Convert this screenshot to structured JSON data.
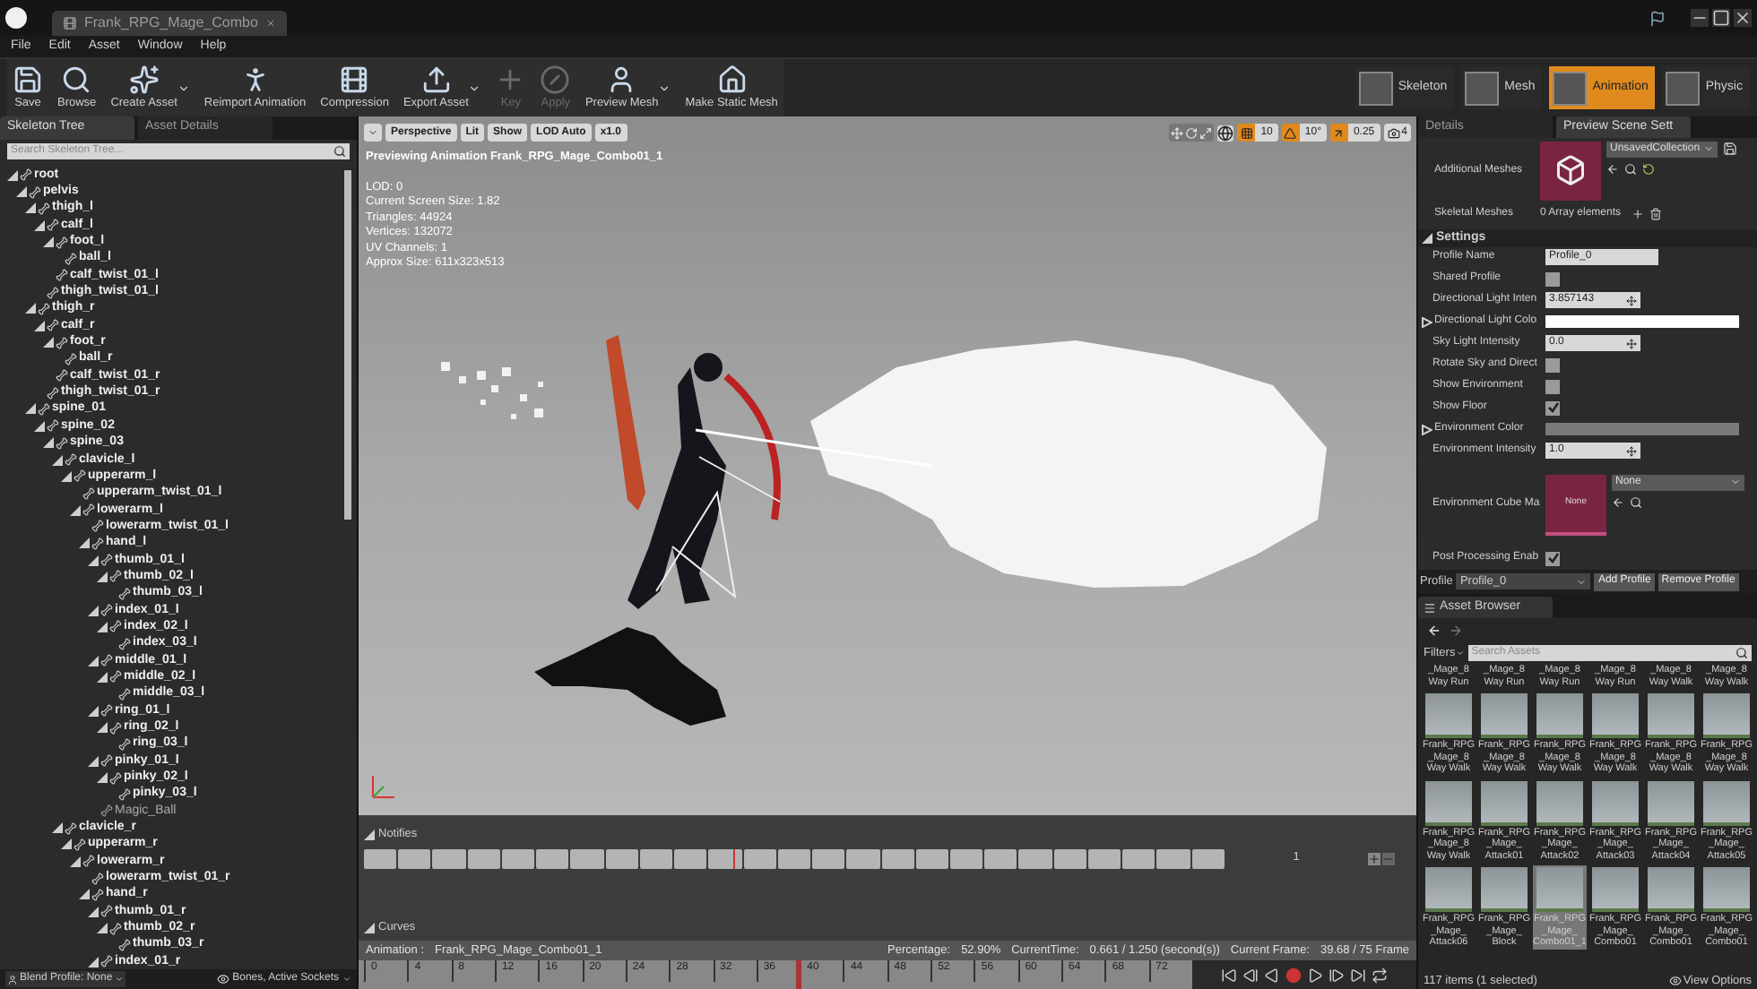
{
  "window": {
    "tab": "Frank_RPG_Mage_Combo"
  },
  "menu": [
    "File",
    "Edit",
    "Asset",
    "Window",
    "Help"
  ],
  "toolbar": [
    {
      "label": "Save",
      "dropdown": false,
      "disabled": false
    },
    {
      "label": "Browse",
      "dropdown": false,
      "disabled": false
    },
    {
      "label": "Create Asset",
      "dropdown": true,
      "disabled": false
    },
    {
      "label": "Reimport Animation",
      "dropdown": false,
      "disabled": false
    },
    {
      "label": "Compression",
      "dropdown": false,
      "disabled": false
    },
    {
      "label": "Export Asset",
      "dropdown": true,
      "disabled": false
    },
    {
      "label": "Key",
      "dropdown": false,
      "disabled": true
    },
    {
      "label": "Apply",
      "dropdown": false,
      "disabled": true
    },
    {
      "label": "Preview Mesh",
      "dropdown": true,
      "disabled": false
    },
    {
      "label": "Make Static Mesh",
      "dropdown": false,
      "disabled": false
    }
  ],
  "modes": [
    {
      "label": "Skeleton",
      "selected": false
    },
    {
      "label": "Mesh",
      "selected": false
    },
    {
      "label": "Animation",
      "selected": true
    },
    {
      "label": "Physic",
      "selected": false
    }
  ],
  "left_panel": {
    "tabs": [
      {
        "label": "Skeleton Tree",
        "selected": true
      },
      {
        "label": "Asset Details",
        "selected": false
      }
    ],
    "search": {
      "placeholder": "Search Skeleton Tree..."
    },
    "tree": [
      {
        "label": "root",
        "kind": "bone",
        "expanded": true,
        "children": [
          {
            "label": "pelvis",
            "kind": "bone",
            "expanded": true,
            "children": [
              {
                "label": "thigh_l",
                "kind": "bone",
                "expanded": true,
                "children": [
                  {
                    "label": "calf_l",
                    "kind": "bone",
                    "expanded": true,
                    "children": [
                      {
                        "label": "foot_l",
                        "kind": "bone",
                        "expanded": true,
                        "children": [
                          {
                            "label": "ball_l",
                            "kind": "bone"
                          }
                        ]
                      },
                      {
                        "label": "calf_twist_01_l",
                        "kind": "bone"
                      }
                    ]
                  },
                  {
                    "label": "thigh_twist_01_l",
                    "kind": "bone"
                  }
                ]
              },
              {
                "label": "thigh_r",
                "kind": "bone",
                "expanded": true,
                "children": [
                  {
                    "label": "calf_r",
                    "kind": "bone",
                    "expanded": true,
                    "children": [
                      {
                        "label": "foot_r",
                        "kind": "bone",
                        "expanded": true,
                        "children": [
                          {
                            "label": "ball_r",
                            "kind": "bone"
                          }
                        ]
                      },
                      {
                        "label": "calf_twist_01_r",
                        "kind": "bone"
                      }
                    ]
                  },
                  {
                    "label": "thigh_twist_01_r",
                    "kind": "bone"
                  }
                ]
              },
              {
                "label": "spine_01",
                "kind": "bone",
                "expanded": true,
                "children": [
                  {
                    "label": "spine_02",
                    "kind": "bone",
                    "expanded": true,
                    "children": [
                      {
                        "label": "spine_03",
                        "kind": "bone",
                        "expanded": true,
                        "children": [
                          {
                            "label": "clavicle_l",
                            "kind": "bone",
                            "expanded": true,
                            "children": [
                              {
                                "label": "upperarm_l",
                                "kind": "bone",
                                "expanded": true,
                                "children": [
                                  {
                                    "label": "upperarm_twist_01_l",
                                    "kind": "bone"
                                  },
                                  {
                                    "label": "lowerarm_l",
                                    "kind": "bone",
                                    "expanded": true,
                                    "children": [
                                      {
                                        "label": "lowerarm_twist_01_l",
                                        "kind": "bone"
                                      },
                                      {
                                        "label": "hand_l",
                                        "kind": "bone",
                                        "expanded": true,
                                        "children": [
                                          {
                                            "label": "thumb_01_l",
                                            "kind": "bone",
                                            "expanded": true,
                                            "children": [
                                              {
                                                "label": "thumb_02_l",
                                                "kind": "bone",
                                                "expanded": true,
                                                "children": [
                                                  {
                                                    "label": "thumb_03_l",
                                                    "kind": "bone"
                                                  }
                                                ]
                                              }
                                            ]
                                          },
                                          {
                                            "label": "index_01_l",
                                            "kind": "bone",
                                            "expanded": true,
                                            "children": [
                                              {
                                                "label": "index_02_l",
                                                "kind": "bone",
                                                "expanded": true,
                                                "children": [
                                                  {
                                                    "label": "index_03_l",
                                                    "kind": "bone"
                                                  }
                                                ]
                                              }
                                            ]
                                          },
                                          {
                                            "label": "middle_01_l",
                                            "kind": "bone",
                                            "expanded": true,
                                            "children": [
                                              {
                                                "label": "middle_02_l",
                                                "kind": "bone",
                                                "expanded": true,
                                                "children": [
                                                  {
                                                    "label": "middle_03_l",
                                                    "kind": "bone"
                                                  }
                                                ]
                                              }
                                            ]
                                          },
                                          {
                                            "label": "ring_01_l",
                                            "kind": "bone",
                                            "expanded": true,
                                            "children": [
                                              {
                                                "label": "ring_02_l",
                                                "kind": "bone",
                                                "expanded": true,
                                                "children": [
                                                  {
                                                    "label": "ring_03_l",
                                                    "kind": "bone"
                                                  }
                                                ]
                                              }
                                            ]
                                          },
                                          {
                                            "label": "pinky_01_l",
                                            "kind": "bone",
                                            "expanded": true,
                                            "children": [
                                              {
                                                "label": "pinky_02_l",
                                                "kind": "bone",
                                                "expanded": true,
                                                "children": [
                                                  {
                                                    "label": "pinky_03_l",
                                                    "kind": "bone"
                                                  }
                                                ]
                                              }
                                            ]
                                          },
                                          {
                                            "label": "Magic_Ball",
                                            "kind": "socket"
                                          }
                                        ]
                                      }
                                    ]
                                  }
                                ]
                              }
                            ]
                          },
                          {
                            "label": "clavicle_r",
                            "kind": "bone",
                            "expanded": true,
                            "children": [
                              {
                                "label": "upperarm_r",
                                "kind": "bone",
                                "expanded": true,
                                "children": [
                                  {
                                    "label": "lowerarm_r",
                                    "kind": "bone",
                                    "expanded": true,
                                    "children": [
                                      {
                                        "label": "lowerarm_twist_01_r",
                                        "kind": "bone"
                                      },
                                      {
                                        "label": "hand_r",
                                        "kind": "bone",
                                        "expanded": true,
                                        "children": [
                                          {
                                            "label": "thumb_01_r",
                                            "kind": "bone",
                                            "expanded": true,
                                            "children": [
                                              {
                                                "label": "thumb_02_r",
                                                "kind": "bone",
                                                "expanded": true,
                                                "children": [
                                                  {
                                                    "label": "thumb_03_r",
                                                    "kind": "bone"
                                                  }
                                                ]
                                              }
                                            ]
                                          },
                                          {
                                            "label": "index_01_r",
                                            "kind": "bone",
                                            "expanded": true
                                          }
                                        ]
                                      }
                                    ]
                                  }
                                ]
                              }
                            ]
                          }
                        ]
                      }
                    ]
                  }
                ]
              }
            ]
          }
        ]
      }
    ],
    "blend_profile": "Blend Profile: None",
    "filter": "Bones, Active Sockets"
  },
  "viewport": {
    "buttons": [
      "Perspective",
      "Lit",
      "Show",
      "LOD Auto",
      "x1.0"
    ],
    "snaps": [
      {
        "value": "10",
        "on": true
      },
      {
        "value": "10°",
        "on": true
      },
      {
        "value": "0.25",
        "on": true
      }
    ],
    "camera_speed": "4",
    "title": "Previewing Animation Frank_RPG_Mage_Combo01_1",
    "stats": [
      "LOD: 0",
      "Current Screen Size: 1.82",
      "Triangles: 44924",
      "Vertices: 132072",
      "UV Channels: 1",
      "Approx Size: 611x323x513"
    ]
  },
  "notifies": {
    "title": "Notifies",
    "track_count": "1",
    "level": 0.43
  },
  "curves": {
    "title": "Curves"
  },
  "status": {
    "animation_label": "Animation :",
    "animation": "Frank_RPG_Mage_Combo01_1",
    "percentage_label": "Percentage:",
    "percentage": "52.90%",
    "time_label": "CurrentTime:",
    "time": "0.661 / 1.250 (second(s))",
    "frame_label": "Current Frame:",
    "frame": "39.68 / 75 Frame"
  },
  "timeline": {
    "ticks": [
      "0",
      "4",
      "8",
      "12",
      "16",
      "20",
      "24",
      "28",
      "32",
      "36",
      "40",
      "44",
      "48",
      "52",
      "56",
      "60",
      "64",
      "68",
      "72"
    ],
    "level": 0.529
  },
  "details": {
    "tabs": [
      {
        "label": "Details",
        "selected": false
      },
      {
        "label": "Preview Scene Sett",
        "selected": true
      }
    ],
    "additional_meshes": {
      "label": "Additional Meshes",
      "collection": "UnsavedCollection"
    },
    "skeletal_meshes": {
      "label": "Skeletal Meshes",
      "value": "0 Array elements"
    },
    "section": "Settings",
    "properties": [
      {
        "label": "Profile Name",
        "kind": "text",
        "value": "Profile_0"
      },
      {
        "label": "Shared Profile",
        "kind": "checkbox",
        "checked": false
      },
      {
        "label": "Directional Light Inten",
        "kind": "number",
        "value": "3.857143"
      },
      {
        "label": "Directional Light Colo",
        "kind": "color",
        "expanded": false,
        "color": "#ffffff"
      },
      {
        "label": "Sky Light Intensity",
        "kind": "number",
        "value": "0.0"
      },
      {
        "label": "Rotate Sky and Direct",
        "kind": "checkbox",
        "checked": false
      },
      {
        "label": "Show Environment",
        "kind": "checkbox",
        "checked": false
      },
      {
        "label": "Show Floor",
        "kind": "checkbox",
        "checked": true
      },
      {
        "label": "Environment Color",
        "kind": "color",
        "expanded": false,
        "color": "#7a7a7a"
      },
      {
        "label": "Environment Intensity",
        "kind": "number",
        "value": "1.0"
      },
      {
        "label": "Environment Cube Ma",
        "kind": "cube",
        "thumb": "None",
        "value": "None"
      },
      {
        "label": "Post Processing Enab",
        "kind": "checkbox",
        "checked": true
      }
    ],
    "profile": {
      "label": "Profile",
      "value": "Profile_0",
      "buttons": [
        "Add Profile",
        "Remove Profile"
      ]
    }
  },
  "asset_browser": {
    "tab": "Asset Browser",
    "filters": "Filters",
    "search": {
      "placeholder": "Search Assets"
    },
    "partial_labels": [
      [
        "_Mage_8",
        "Way Run"
      ],
      [
        "_Mage_8",
        "Way Run"
      ],
      [
        "_Mage_8",
        "Way Run"
      ],
      [
        "_Mage_8",
        "Way Run"
      ],
      [
        "_Mage_8",
        "Way Walk"
      ],
      [
        "_Mage_8",
        "Way Walk"
      ]
    ],
    "assets": [
      {
        "lines": [
          "Frank_RPG",
          "_Mage_8",
          "Way Walk"
        ],
        "selected": false
      },
      {
        "lines": [
          "Frank_RPG",
          "_Mage_8",
          "Way Walk"
        ],
        "selected": false
      },
      {
        "lines": [
          "Frank_RPG",
          "_Mage_8",
          "Way Walk"
        ],
        "selected": false
      },
      {
        "lines": [
          "Frank_RPG",
          "_Mage_8",
          "Way Walk"
        ],
        "selected": false
      },
      {
        "lines": [
          "Frank_RPG",
          "_Mage_8",
          "Way Walk"
        ],
        "selected": false
      },
      {
        "lines": [
          "Frank_RPG",
          "_Mage_8",
          "Way Walk"
        ],
        "selected": false
      },
      {
        "lines": [
          "Frank_RPG",
          "_Mage_8",
          "Way Walk"
        ],
        "selected": false
      },
      {
        "lines": [
          "Frank_RPG",
          "_Mage_",
          "Attack01"
        ],
        "selected": false
      },
      {
        "lines": [
          "Frank_RPG",
          "_Mage_",
          "Attack02"
        ],
        "selected": false
      },
      {
        "lines": [
          "Frank_RPG",
          "_Mage_",
          "Attack03"
        ],
        "selected": false
      },
      {
        "lines": [
          "Frank_RPG",
          "_Mage_",
          "Attack04"
        ],
        "selected": false
      },
      {
        "lines": [
          "Frank_RPG",
          "_Mage_",
          "Attack05"
        ],
        "selected": false
      },
      {
        "lines": [
          "Frank_RPG",
          "_Mage_",
          "Attack06"
        ],
        "selected": false
      },
      {
        "lines": [
          "Frank_RPG",
          "_Mage_",
          "Block"
        ],
        "selected": false
      },
      {
        "lines": [
          "Frank_RPG",
          "_Mage_",
          "Combo01_1"
        ],
        "selected": true
      },
      {
        "lines": [
          "Frank_RPG",
          "_Mage_",
          "Combo01"
        ],
        "selected": false
      },
      {
        "lines": [
          "Frank_RPG",
          "_Mage_",
          "Combo01"
        ],
        "selected": false
      },
      {
        "lines": [
          "Frank_RPG",
          "_Mage_",
          "Combo01"
        ],
        "selected": false
      }
    ],
    "count": "117 items (1 selected)",
    "view_options": "View Options"
  }
}
